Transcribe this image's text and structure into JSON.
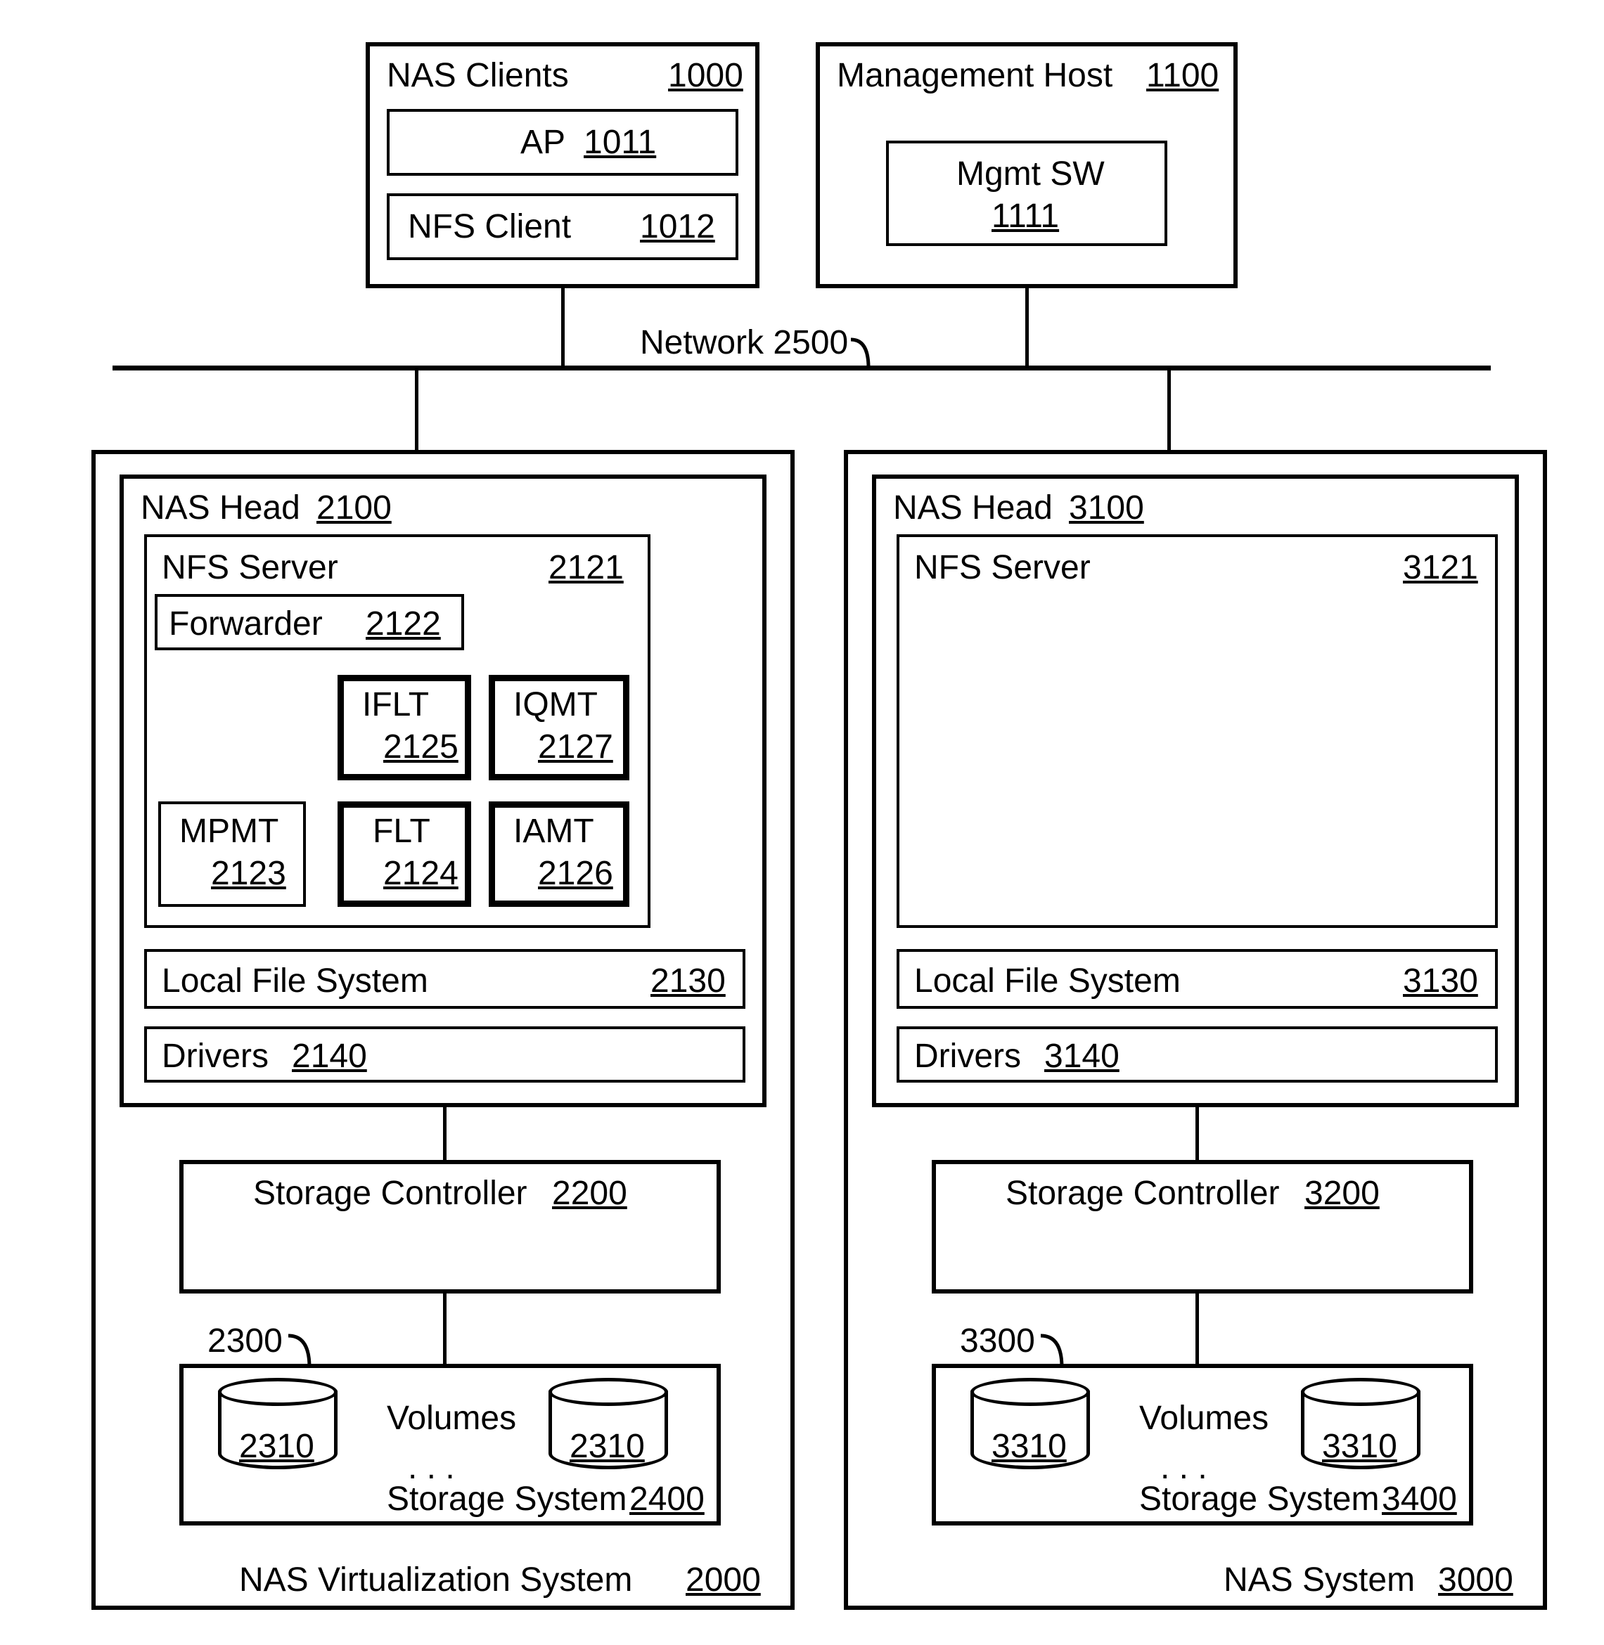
{
  "network_label": "Network 2500",
  "nas_clients": {
    "title": "NAS Clients",
    "id": "1000",
    "ap_label": "AP",
    "ap_id": "1011",
    "nfs_client_label": "NFS Client",
    "nfs_client_id": "1012"
  },
  "mgmt_host": {
    "title": "Management Host",
    "id": "1100",
    "mgmt_sw_label": "Mgmt SW",
    "mgmt_sw_id": "1111"
  },
  "nas_virt": {
    "title": "NAS Virtualization System",
    "id": "2000",
    "nas_head": {
      "title": "NAS Head",
      "id": "2100"
    },
    "nfs_server": {
      "title": "NFS Server",
      "id": "2121",
      "forwarder": {
        "title": "Forwarder",
        "id": "2122"
      },
      "mpmt": {
        "title": "MPMT",
        "id": "2123"
      },
      "iflt": {
        "title": "IFLT",
        "id": "2125"
      },
      "iqmt": {
        "title": "IQMT",
        "id": "2127"
      },
      "flt": {
        "title": "FLT",
        "id": "2124"
      },
      "iamt": {
        "title": "IAMT",
        "id": "2126"
      }
    },
    "lfs": {
      "title": "Local File System",
      "id": "2130"
    },
    "drivers": {
      "title": "Drivers",
      "id": "2140"
    },
    "storage_ctrl": {
      "title": "Storage Controller",
      "id": "2200"
    },
    "disk_unit_id": "2300",
    "volumes_label": "Volumes",
    "vol_id": "2310",
    "storage_sys": {
      "title": "Storage System",
      "id": "2400"
    },
    "dots": ". . ."
  },
  "nas_sys": {
    "title": "NAS System",
    "id": "3000",
    "nas_head": {
      "title": "NAS Head",
      "id": "3100"
    },
    "nfs_server": {
      "title": "NFS Server",
      "id": "3121"
    },
    "lfs": {
      "title": "Local File System",
      "id": "3130"
    },
    "drivers": {
      "title": "Drivers",
      "id": "3140"
    },
    "storage_ctrl": {
      "title": "Storage Controller",
      "id": "3200"
    },
    "disk_unit_id": "3300",
    "volumes_label": "Volumes",
    "vol_id": "3310",
    "storage_sys": {
      "title": "Storage System",
      "id": "3400"
    },
    "dots": ". . ."
  }
}
